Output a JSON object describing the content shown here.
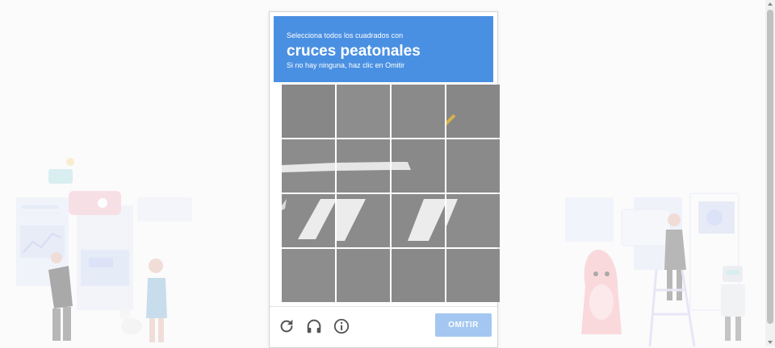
{
  "captcha": {
    "instruction_lead": "Selecciona todos los cuadrados con",
    "instruction_target": "cruces peatonales",
    "instruction_hint": "Si no hay ninguna, haz clic en Omitir",
    "header_color": "#4a90e2",
    "grid": {
      "rows": 4,
      "columns": 4
    },
    "footer": {
      "reload_icon": "reload-icon",
      "audio_icon": "headphones-icon",
      "info_icon": "info-icon",
      "skip_label": "OMITIR",
      "skip_color": "#a3c7f0"
    }
  },
  "colors": {
    "asphalt": "#8b8b8b",
    "page_background": "#fafafa"
  }
}
